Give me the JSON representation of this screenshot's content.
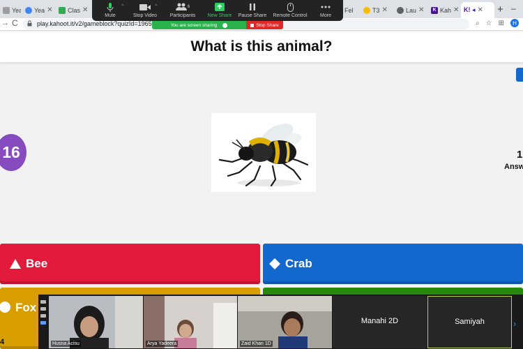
{
  "browser": {
    "tabs": [
      {
        "label": "Yea",
        "color": "#9e9e9e"
      },
      {
        "label": "Yea",
        "color": "#4285f4"
      },
      {
        "label": "Clas",
        "color": "#34a853"
      },
      {
        "label": "Fel",
        "color": "#9e9e9e"
      },
      {
        "label": "T3",
        "color": "#fbbc04"
      },
      {
        "label": "Lau",
        "color": "#5f6368"
      },
      {
        "label": "Kah",
        "color": "#46178f"
      }
    ],
    "active_tab_label": "K! ◂",
    "url": "play.kahoot.it/v2/gameblock?quizId=1965bb",
    "profile_initial": "H"
  },
  "zoom_toolbar": {
    "mute": "Mute",
    "stop_video": "Stop Video",
    "participants": "Participants",
    "participants_count": "6",
    "new_share": "New Share",
    "pause_share": "Pause Share",
    "remote_control": "Remote Control",
    "more": "More",
    "sharing_status": "You are screen sharing",
    "stop_share": "Stop Share"
  },
  "quiz": {
    "question": "What is this animal?",
    "timer": "16",
    "answers_count": "1",
    "answers_label": "Answ",
    "answers": [
      {
        "label": "Bee",
        "color": "#e21b3c",
        "shape": "triangle"
      },
      {
        "label": "Crab",
        "color": "#1368ce",
        "shape": "diamond"
      },
      {
        "label": "Fox",
        "color": "#d89e00",
        "shape": "circle"
      },
      {
        "label": "",
        "color": "#26890c",
        "shape": "square"
      }
    ]
  },
  "gallery": {
    "participants": [
      {
        "name": "Husna Acisu"
      },
      {
        "name": "Arya Yadeera"
      },
      {
        "name": "Zaid Khan 1D"
      },
      {
        "name": "Manahi 2D"
      },
      {
        "name": "Samiyah"
      }
    ],
    "left_edge_text": "4"
  }
}
